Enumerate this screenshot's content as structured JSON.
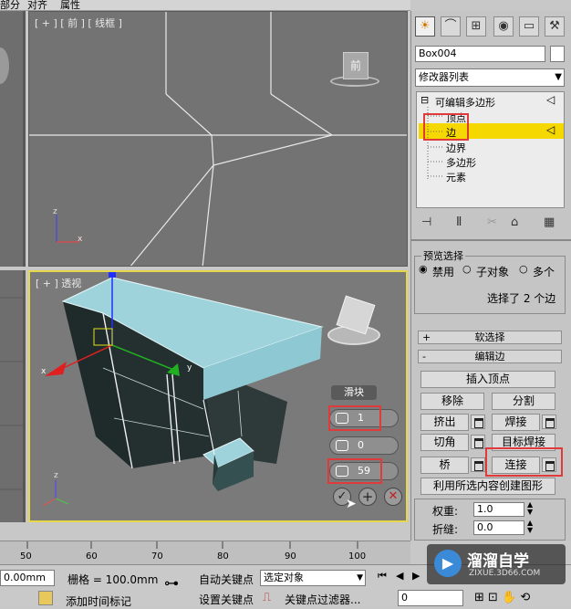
{
  "menu": [
    "部分",
    "对齐",
    "属性"
  ],
  "viewports": {
    "front_label": "[ + ] [ 前 ] [ 线框 ]",
    "front_cube": "前",
    "persp_label": "[ + ] 透视",
    "axis_x": "x",
    "axis_y": "y",
    "axis_z": "z"
  },
  "caddy": {
    "title": "滑块",
    "segments": "1",
    "pinch": "0",
    "slide": "59"
  },
  "panel": {
    "object_name": "Box004",
    "object_color": "#ffffff",
    "modifier_list": "修改器列表",
    "stack": {
      "root": "可编辑多边形",
      "items": [
        "顶点",
        "边",
        "边界",
        "多边形",
        "元素"
      ],
      "selected_index": 1
    },
    "preview": {
      "title": "预览选择",
      "options": [
        "禁用",
        "子对象",
        "多个"
      ],
      "selected": "禁用",
      "status": "选择了 2 个边"
    },
    "rollouts": {
      "soft_select": "软选择",
      "edit_edges": "编辑边"
    },
    "buttons": {
      "insert_vertex": "插入顶点",
      "remove": "移除",
      "split": "分割",
      "extrude": "挤出",
      "weld": "焊接",
      "chamfer": "切角",
      "target_weld": "目标焊接",
      "bridge": "桥",
      "connect": "连接",
      "create_shape": "利用所选内容创建图形"
    },
    "weight_label": "权重:",
    "weight_value": "1.0",
    "crease_label": "折缝:",
    "crease_value": "0.0"
  },
  "timeline": {
    "ticks": [
      "50",
      "60",
      "70",
      "80",
      "90",
      "100"
    ]
  },
  "status": {
    "coord": "0.00mm",
    "grid": "栅格 = 100.0mm",
    "auto_key": "自动关键点",
    "set_key": "设置关键点",
    "selected_object": "选定对象",
    "key_filter": "关键点过滤器...",
    "add_time_tag": "添加时间标记",
    "frame": "0"
  },
  "watermark": {
    "brand": "溜溜自学",
    "url": "ZIXUE.3D66.COM"
  },
  "colors": {
    "selection_highlight": "#f5d800",
    "active_viewport_border": "#e6d84a",
    "annotation_red": "#e03a3a",
    "box_top": "#9ed3dc",
    "box_side": "#1f2a2a"
  }
}
